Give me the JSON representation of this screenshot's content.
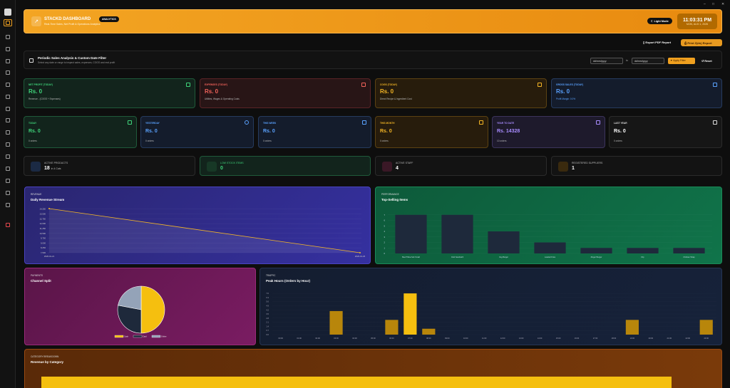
{
  "window": {
    "min": "–",
    "max": "□",
    "close": "✕"
  },
  "sidebar": {
    "items": [
      "logo-icon",
      "dashboard-icon",
      "pos-icon",
      "orders-icon",
      "menu-icon",
      "inventory-icon",
      "recipes-icon",
      "transfers-icon",
      "delivery-icon",
      "staff-icon",
      "reports-icon",
      "customers-icon",
      "suppliers-icon",
      "analytics-icon",
      "tags-icon",
      "settings-icon",
      "help-icon",
      "logout-icon"
    ]
  },
  "header": {
    "title": "STACKD DASHBOARD",
    "badge": "ANALYTICS",
    "subtitle": "Real-Time Sales, Net Profit & Operations Analytics",
    "light_mode": "Light Mode",
    "time": "11:03:31 PM",
    "date": "MON, AUG 1, 2026"
  },
  "actions": {
    "export_pdf": "Export PDF Report",
    "print": "Print Z(dn) Report"
  },
  "filter": {
    "title": "Periodic Sales Analysis & Custom Date Filter",
    "subtitle": "Select any date or range to inspect sales, expenses, COGS and real profit",
    "from_placeholder": "dd/mm/yyyy",
    "to_label": "to",
    "to_placeholder": "dd/mm/yyyy",
    "apply": "Apply Filter",
    "reset": "Reset"
  },
  "kpis": [
    {
      "label": "NET PROFIT (TODAY)",
      "value": "Rs. 0",
      "footer": "Revenue - (COGS + Expenses)",
      "color": "#3fd47a",
      "icon": "trend-icon"
    },
    {
      "label": "EXPENSES (TODAY)",
      "value": "Rs. 0",
      "footer": "Utilities, Wages & Operating Costs",
      "color": "#f0625a",
      "icon": "dollar-icon"
    },
    {
      "label": "COGS (TODAY)",
      "value": "Rs. 0",
      "footer": "Direct Recipe & Ingredient Cost",
      "color": "#f5b625",
      "icon": "box-icon"
    },
    {
      "label": "GROSS SALES (TODAY)",
      "value": "Rs. 0",
      "footer": "Profit Margin: 0.0%",
      "color": "#5aa2ff",
      "icon": "receipt-icon"
    }
  ],
  "periods": [
    {
      "label": "TODAY",
      "value": "Rs. 0",
      "footer": "0 orders",
      "color": "#3fd47a",
      "icon": "trend-icon"
    },
    {
      "label": "YESTERDAY",
      "value": "Rs. 0",
      "footer": "0 orders",
      "color": "#5aa2ff",
      "icon": "clock-icon"
    },
    {
      "label": "THIS WEEK",
      "value": "Rs. 0",
      "footer": "0 orders",
      "color": "#5aa2ff",
      "icon": "chart-icon"
    },
    {
      "label": "THIS MONTH",
      "value": "Rs. 0",
      "footer": "0 orders",
      "color": "#f5b625",
      "icon": "calendar-icon"
    },
    {
      "label": "YEAR TO DATE",
      "value": "Rs. 14328",
      "footer": "10 orders",
      "color": "#a88cff",
      "icon": "layers-icon"
    },
    {
      "label": "LAST YEAR",
      "value": "Rs. 0",
      "footer": "0 orders",
      "color": "#dddddd",
      "icon": "archive-icon"
    }
  ],
  "stats": [
    {
      "label": "ACTIVE PRODUCTS",
      "value": "18",
      "sub": "in 4 Cats",
      "color": "#5aa2ff",
      "bg": "#1b2a44",
      "icon": "products-icon"
    },
    {
      "label": "LOW STOCK ITEMS",
      "value": "0",
      "sub": "",
      "color": "#3fd47a",
      "bg": "#173826",
      "icon": "alert-icon"
    },
    {
      "label": "ACTIVE STAFF",
      "value": "4",
      "sub": "",
      "color": "#e0507a",
      "bg": "#3a1826",
      "icon": "staff-icon"
    },
    {
      "label": "REGISTERED SUPPLIERS",
      "value": "1",
      "sub": "",
      "color": "#f5b625",
      "bg": "#3a2a0e",
      "icon": "truck-icon"
    }
  ],
  "charts": {
    "revenue": {
      "label": "REVENUE",
      "title": "Daily Revenue Stream"
    },
    "performance": {
      "label": "PERFORMANCE",
      "title": "Top-Selling Items"
    },
    "payments": {
      "label": "PAYMENTS",
      "title": "Channel Split"
    },
    "traffic": {
      "label": "TRAFFIC",
      "title": "Peak Hours (Orders by Hour)"
    },
    "category": {
      "label": "CATEGORY BREAKDOWN",
      "title": "Revenue by Category"
    }
  },
  "chart_data": [
    {
      "type": "area",
      "x": [
        "2026-01-21",
        "2026-01-26"
      ],
      "y": [
        14328,
        7500
      ],
      "yticks": [
        7500,
        8250,
        9000,
        9750,
        10500,
        11250,
        12000,
        12750,
        13500,
        14250
      ],
      "ylim": [
        7500,
        14328
      ],
      "color": "#f5b625"
    },
    {
      "type": "bar",
      "categories": [
        "Beef Tikka Sub Small",
        "Club Sandwich",
        "Veg Burger",
        "Loaded Fries",
        "Zinger Burger",
        "Dip",
        "Chicken Wrap"
      ],
      "values": [
        7,
        7,
        4,
        2,
        1,
        1,
        1
      ],
      "ylim": [
        0,
        8
      ],
      "color": "#1e293b"
    },
    {
      "type": "pie",
      "categories": [
        "Cash",
        "Card",
        "Online"
      ],
      "values": [
        50,
        28,
        22
      ],
      "colors": [
        "#f5bf0f",
        "#1e293b",
        "#94a3b8"
      ]
    },
    {
      "type": "bar",
      "categories": [
        "00:00",
        "01:00",
        "02:00",
        "03:00",
        "04:00",
        "05:00",
        "06:00",
        "07:00",
        "08:00",
        "09:00",
        "10:00",
        "11:00",
        "12:00",
        "13:00",
        "14:00",
        "15:00",
        "16:00",
        "17:00",
        "18:00",
        "19:00",
        "20:00",
        "21:00",
        "22:00",
        "23:00"
      ],
      "values": [
        0,
        0,
        0,
        4,
        0,
        0,
        2.5,
        7,
        1,
        0,
        0,
        0,
        0,
        0,
        0,
        0,
        0,
        0,
        0,
        2.5,
        0,
        0,
        0,
        2.5
      ],
      "yticks": [
        0,
        0.7,
        1.4,
        2.1,
        2.8,
        3.5,
        4.2,
        4.9,
        5.6,
        6.3,
        7
      ],
      "ylim": [
        0,
        7.5
      ],
      "color": "#b8860b"
    }
  ]
}
